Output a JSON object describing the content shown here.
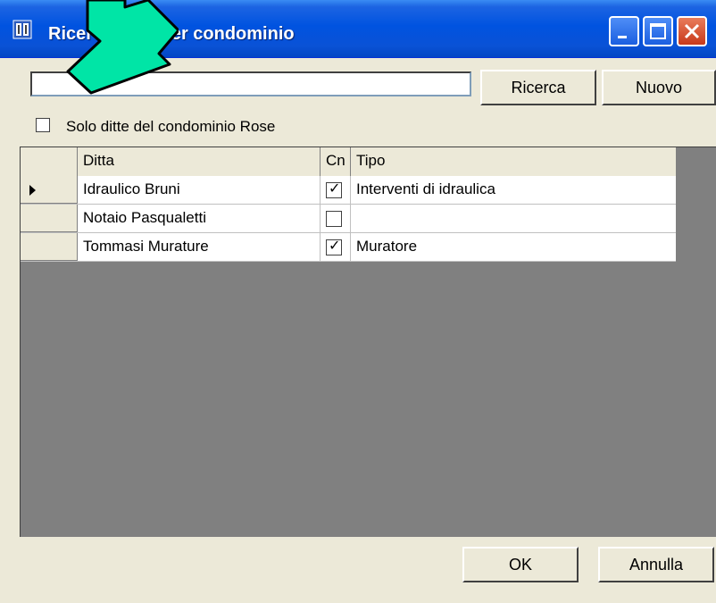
{
  "window": {
    "title": "Ricerca ditta per condominio"
  },
  "search": {
    "value": "",
    "placeholder": ""
  },
  "buttons": {
    "search_label": "Ricerca",
    "new_label": "Nuovo",
    "ok_label": "OK",
    "cancel_label": "Annulla"
  },
  "filter": {
    "label": "Solo ditte del condominio Rose",
    "checked": false
  },
  "table": {
    "columns": [
      "Ditta",
      "Cn",
      "Tipo"
    ],
    "rows": [
      {
        "ditta": "Idraulico Bruni",
        "cn": true,
        "tipo": "Interventi di idraulica",
        "current": true
      },
      {
        "ditta": "Notaio Pasqualetti",
        "cn": false,
        "tipo": "",
        "current": false
      },
      {
        "ditta": "Tommasi Murature",
        "cn": true,
        "tipo": "Muratore",
        "current": false
      }
    ]
  },
  "colors": {
    "titlebar": "#0053e0",
    "pointer": "#00e5a6"
  }
}
